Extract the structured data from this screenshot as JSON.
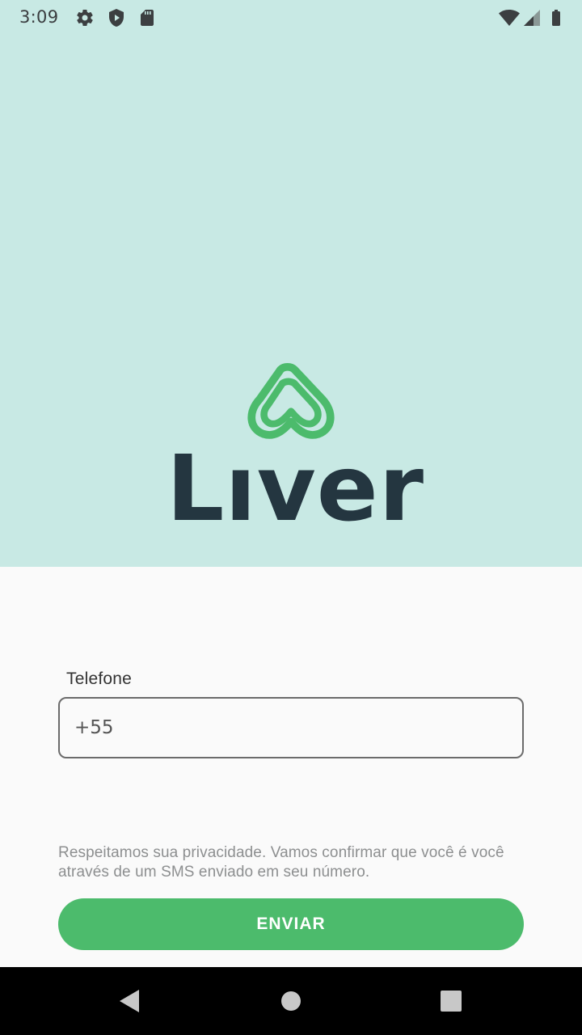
{
  "status_bar": {
    "time": "3:09",
    "icons_left": [
      "settings-gear-icon",
      "shield-play-icon",
      "sd-card-icon"
    ],
    "icons_right": [
      "wifi-icon",
      "cellular-signal-icon",
      "battery-icon"
    ]
  },
  "brand": {
    "logo_icon": "liver-heart-logo-icon",
    "name": "Lıver",
    "green": "#4cbb6c",
    "dark": "#243640",
    "hero_background": "#c8e9e4"
  },
  "form": {
    "phone_label": "Telefone",
    "phone_value": "+55",
    "privacy_text": "Respeitamos sua privacidade. Vamos confirmar que você é você através de um SMS enviado em seu número.",
    "submit_label": "ENVIAR"
  },
  "nav_bar": {
    "icons": [
      "back-triangle-icon",
      "home-circle-icon",
      "recents-square-icon"
    ]
  }
}
